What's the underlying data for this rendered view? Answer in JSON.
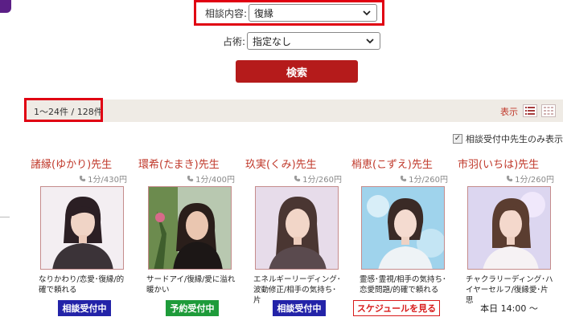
{
  "search": {
    "consultation_label": "相談内容:",
    "consultation_value": "復縁",
    "divination_label": "占術:",
    "divination_value": "指定なし",
    "search_button": "検索"
  },
  "results": {
    "count": "1〜24件 / 128件",
    "display_label": "表示",
    "filter_label": "相談受付中先生のみ表示",
    "filter_checked": true
  },
  "icons": {
    "phone": "phone-icon",
    "list_view": "list-view-icon",
    "grid_view": "grid-view-icon",
    "dropdown": "chevron-down-icon"
  },
  "colors": {
    "accent_red": "#c0392b",
    "button_red": "#b51b1b",
    "highlight_red": "#e00012",
    "status_blue": "#2323a8",
    "status_green": "#1e9b3a"
  },
  "fortune_tellers": [
    {
      "name": "諸縁(ゆかり)先生",
      "price": "1分/430円",
      "desc": "なりかわり/恋愛･復縁/的確で頼れる",
      "status": "相談受付中",
      "status_type": "blue"
    },
    {
      "name": "環希(たまき)先生",
      "price": "1分/400円",
      "desc": "サードアイ/復縁/愛に溢れ暖かい",
      "status": "予約受付中",
      "status_type": "green"
    },
    {
      "name": "玖実(くみ)先生",
      "price": "1分/260円",
      "desc": "エネルギーリーディング･波動修正/相手の気持ち･片",
      "status": "相談受付中",
      "status_type": "blue"
    },
    {
      "name": "梢恵(こずえ)先生",
      "price": "1分/260円",
      "desc": "霊感･霊視/相手の気持ち･恋愛問題/的確で頼れる",
      "status": "スケジュールを見る",
      "status_type": "sched"
    },
    {
      "name": "市羽(いちは)先生",
      "price": "1分/260円",
      "desc": "チャクラリーディング･ハイヤーセルフ/復縁愛･片思",
      "status": "本日 14:00 〜",
      "status_type": "time"
    }
  ]
}
